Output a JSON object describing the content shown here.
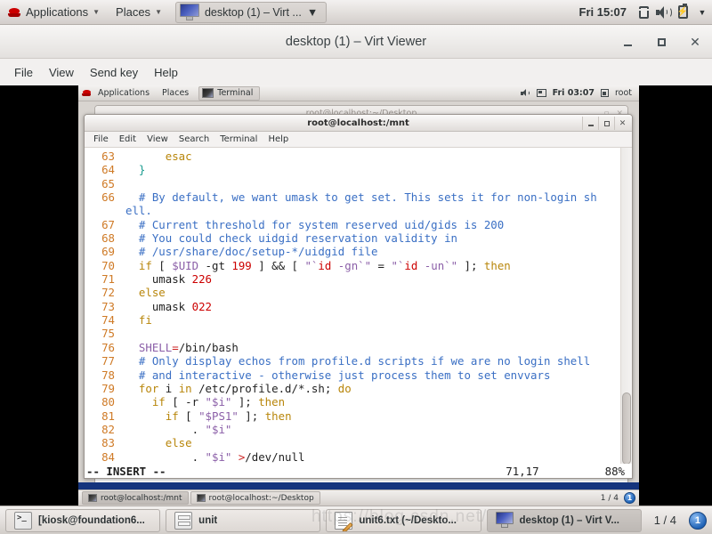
{
  "host_panel": {
    "applications_label": "Applications",
    "places_label": "Places",
    "window_button_label": "desktop (1) – Virt ...",
    "clock": "Fri 15:07",
    "caret": "▼",
    "tray": [
      "display-icon",
      "volume-icon",
      "battery-icon",
      "chevron-down-icon"
    ]
  },
  "virt_viewer": {
    "title": "desktop (1) – Virt Viewer",
    "menus": [
      "File",
      "View",
      "Send key",
      "Help"
    ],
    "window_buttons": [
      "minimize",
      "maximize",
      "close"
    ]
  },
  "guest_panel": {
    "applications_label": "Applications",
    "places_label": "Places",
    "window_button_label": "Terminal",
    "clock": "Fri 03:07",
    "user": "root"
  },
  "background_window": {
    "title": "root@localhost:~/Desktop"
  },
  "terminal": {
    "title": "root@localhost:/mnt",
    "menus": [
      "File",
      "Edit",
      "View",
      "Search",
      "Terminal",
      "Help"
    ],
    "status_mode": "-- INSERT --",
    "status_position": "71,17",
    "status_percent": "88%",
    "lines": [
      {
        "num": "63",
        "tokens": [
          {
            "t": "      ",
            "c": "plain"
          },
          {
            "t": "esac",
            "c": "key"
          }
        ]
      },
      {
        "num": "64",
        "tokens": [
          {
            "t": "  ",
            "c": "plain"
          },
          {
            "t": "}",
            "c": "brace"
          }
        ]
      },
      {
        "num": "65",
        "tokens": []
      },
      {
        "num": "66",
        "tokens": [
          {
            "t": "  ",
            "c": "plain"
          },
          {
            "t": "# By default, we want umask to get set. This sets it for non-login sh",
            "c": "com"
          }
        ],
        "wrap": [
          {
            "t": "ell.",
            "c": "com"
          }
        ]
      },
      {
        "num": "67",
        "tokens": [
          {
            "t": "  ",
            "c": "plain"
          },
          {
            "t": "# Current threshold for system reserved uid/gids is 200",
            "c": "com"
          }
        ]
      },
      {
        "num": "68",
        "tokens": [
          {
            "t": "  ",
            "c": "plain"
          },
          {
            "t": "# You could check uidgid reservation validity in",
            "c": "com"
          }
        ]
      },
      {
        "num": "69",
        "tokens": [
          {
            "t": "  ",
            "c": "plain"
          },
          {
            "t": "# /usr/share/doc/setup-*/uidgid file",
            "c": "com"
          }
        ]
      },
      {
        "num": "70",
        "tokens": [
          {
            "t": "  ",
            "c": "plain"
          },
          {
            "t": "if",
            "c": "key"
          },
          {
            "t": " [ ",
            "c": "plain"
          },
          {
            "t": "$UID",
            "c": "str"
          },
          {
            "t": " -gt ",
            "c": "plain"
          },
          {
            "t": "199",
            "c": "num"
          },
          {
            "t": " ] && [ ",
            "c": "plain"
          },
          {
            "t": "\"`",
            "c": "str"
          },
          {
            "t": "id",
            "c": "num"
          },
          {
            "t": " -gn`\"",
            "c": "str"
          },
          {
            "t": " = ",
            "c": "plain"
          },
          {
            "t": "\"`",
            "c": "str"
          },
          {
            "t": "id",
            "c": "num"
          },
          {
            "t": " -un`\"",
            "c": "str"
          },
          {
            "t": " ]; ",
            "c": "plain"
          },
          {
            "t": "then",
            "c": "key"
          }
        ]
      },
      {
        "num": "71",
        "tokens": [
          {
            "t": "    umask ",
            "c": "plain"
          },
          {
            "t": "226",
            "c": "num"
          }
        ]
      },
      {
        "num": "72",
        "tokens": [
          {
            "t": "  ",
            "c": "plain"
          },
          {
            "t": "else",
            "c": "key"
          }
        ]
      },
      {
        "num": "73",
        "tokens": [
          {
            "t": "    umask ",
            "c": "plain"
          },
          {
            "t": "022",
            "c": "num"
          }
        ]
      },
      {
        "num": "74",
        "tokens": [
          {
            "t": "  ",
            "c": "plain"
          },
          {
            "t": "fi",
            "c": "key"
          }
        ]
      },
      {
        "num": "75",
        "tokens": []
      },
      {
        "num": "76",
        "tokens": [
          {
            "t": "  ",
            "c": "plain"
          },
          {
            "t": "SHELL",
            "c": "str"
          },
          {
            "t": "=",
            "c": "op"
          },
          {
            "t": "/bin/bash",
            "c": "plain"
          }
        ]
      },
      {
        "num": "77",
        "tokens": [
          {
            "t": "  ",
            "c": "plain"
          },
          {
            "t": "# Only display echos from profile.d scripts if we are no login shell",
            "c": "com"
          }
        ]
      },
      {
        "num": "78",
        "tokens": [
          {
            "t": "  ",
            "c": "plain"
          },
          {
            "t": "# and interactive - otherwise just process them to set envvars",
            "c": "com"
          }
        ]
      },
      {
        "num": "79",
        "tokens": [
          {
            "t": "  ",
            "c": "plain"
          },
          {
            "t": "for",
            "c": "key"
          },
          {
            "t": " i ",
            "c": "plain"
          },
          {
            "t": "in",
            "c": "key"
          },
          {
            "t": " /etc/profile.d/*.sh; ",
            "c": "plain"
          },
          {
            "t": "do",
            "c": "key"
          }
        ]
      },
      {
        "num": "80",
        "tokens": [
          {
            "t": "    ",
            "c": "plain"
          },
          {
            "t": "if",
            "c": "key"
          },
          {
            "t": " [ -r ",
            "c": "plain"
          },
          {
            "t": "\"$i\"",
            "c": "str"
          },
          {
            "t": " ]; ",
            "c": "plain"
          },
          {
            "t": "then",
            "c": "key"
          }
        ]
      },
      {
        "num": "81",
        "tokens": [
          {
            "t": "      ",
            "c": "plain"
          },
          {
            "t": "if",
            "c": "key"
          },
          {
            "t": " [ ",
            "c": "plain"
          },
          {
            "t": "\"$PS1\"",
            "c": "str"
          },
          {
            "t": " ]; ",
            "c": "plain"
          },
          {
            "t": "then",
            "c": "key"
          }
        ]
      },
      {
        "num": "82",
        "tokens": [
          {
            "t": "          . ",
            "c": "plain"
          },
          {
            "t": "\"$i\"",
            "c": "str"
          }
        ]
      },
      {
        "num": "83",
        "tokens": [
          {
            "t": "      ",
            "c": "plain"
          },
          {
            "t": "else",
            "c": "key"
          }
        ]
      },
      {
        "num": "84",
        "tokens": [
          {
            "t": "          . ",
            "c": "plain"
          },
          {
            "t": "\"$i\"",
            "c": "str"
          },
          {
            "t": " >",
            "c": "op"
          },
          {
            "t": "/dev/null",
            "c": "plain"
          }
        ]
      }
    ]
  },
  "guest_taskbar": {
    "tasks": [
      {
        "label": "root@localhost:/mnt",
        "active": true
      },
      {
        "label": "root@localhost:~/Desktop",
        "active": false
      }
    ],
    "pager": "1 / 4",
    "badge": "1"
  },
  "host_taskbar": {
    "tasks": [
      {
        "label": "[kiosk@foundation6...",
        "icon": "terminal-icon",
        "active": false
      },
      {
        "label": "unit",
        "icon": "files-icon",
        "active": false
      },
      {
        "label": "unit6.txt (~/Deskto...",
        "icon": "text-editor-icon",
        "active": false
      },
      {
        "label": "desktop (1) – Virt V...",
        "icon": "vm-display-icon",
        "active": true
      }
    ],
    "pager": "1 / 4",
    "badge": "1"
  },
  "watermark": "https://blog.csdn.net/",
  "colors": {
    "comment": "#3a6fc4",
    "keyword": "#b8860b",
    "string": "#8b5fa8",
    "number": "#cc0000",
    "linenumber": "#cf7a26",
    "brace": "#1a9b8f",
    "panel_blue": "#15347d"
  }
}
